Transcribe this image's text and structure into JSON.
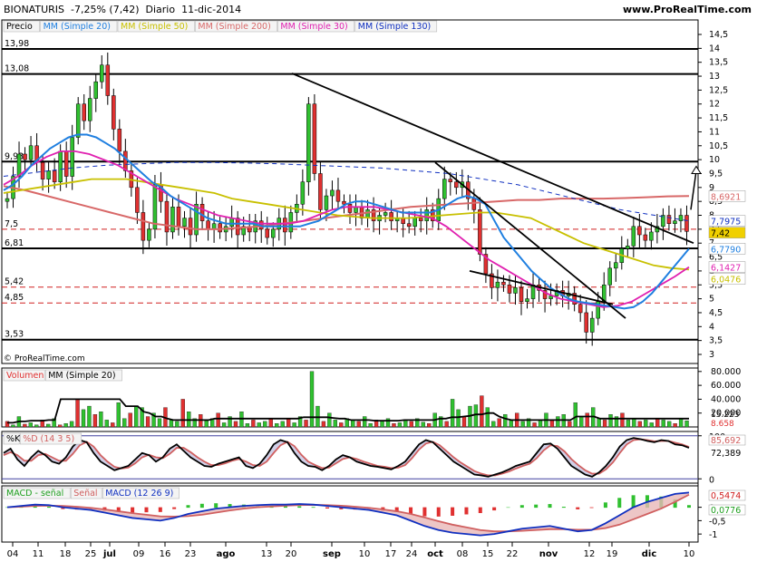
{
  "header": {
    "ticker": "BIONATURIS",
    "change": "-7,25% (7,42)",
    "period": "Diario",
    "date": "11-dic-2014",
    "site": "www.ProRealTime.com"
  },
  "colors": {
    "sma20": "#1f7fe0",
    "sma50": "#c8c000",
    "sma200": "#d86868",
    "sma30": "#e020b0",
    "sma130": "#1030c0",
    "up_candle": "#30c030",
    "down_candle": "#e03030",
    "panel_border": "#000000"
  },
  "chart_data": [
    {
      "type": "candlestick",
      "panel": "price",
      "legend": [
        "Precio",
        "MM (Simple 20)",
        "MM (Simple 50)",
        "MM (Simple 200)",
        "MM (Simple 30)",
        "MM (Simple 130)"
      ],
      "y_ticks": [
        "14,5",
        "14",
        "13,5",
        "13",
        "12,5",
        "12",
        "11,5",
        "11",
        "10,5",
        "10",
        "9,5",
        "9",
        "8,5",
        "8",
        "7,5",
        "7",
        "6,5",
        "6",
        "5,5",
        "5",
        "4,5",
        "4",
        "3,5",
        "3"
      ],
      "ylim": [
        3,
        14.5
      ],
      "x_ticks": [
        "04",
        "11",
        "18",
        "25",
        "jul",
        "09",
        "16",
        "23",
        "ago",
        "13",
        "20",
        "sep",
        "10",
        "17",
        "24",
        "oct",
        "08",
        "15",
        "22",
        "nov",
        "12",
        "19",
        "dic",
        "10"
      ],
      "last_price": 7.42,
      "value_labels": {
        "sma130": "7,7975",
        "last": "7,42",
        "sma200": "8,6921",
        "sma20": "6,7790",
        "sma30": "6,1427",
        "sma50": "6,0476"
      },
      "horizontal_levels": [
        {
          "value": 13.98,
          "label": "13,98",
          "style": "solid"
        },
        {
          "value": 13.08,
          "label": "13,08",
          "style": "solid"
        },
        {
          "value": 9.93,
          "label": "9,93",
          "style": "solid"
        },
        {
          "value": 7.5,
          "label": "7,5",
          "style": "dashed-red"
        },
        {
          "value": 6.81,
          "label": "6,81",
          "style": "solid"
        },
        {
          "value": 5.42,
          "label": "5,42",
          "style": "dashed-red"
        },
        {
          "value": 4.85,
          "label": "4,85",
          "style": "dashed-red"
        },
        {
          "value": 3.53,
          "label": "3,53",
          "style": "solid"
        }
      ],
      "closes": [
        8.6,
        9.4,
        10.2,
        10.0,
        10.5,
        9.9,
        9.3,
        9.6,
        9.2,
        10.3,
        9.4,
        10.8,
        12.0,
        11.4,
        12.2,
        12.8,
        13.4,
        12.3,
        11.1,
        10.3,
        9.6,
        9.0,
        8.1,
        7.1,
        7.5,
        9.1,
        8.5,
        7.4,
        8.3,
        7.6,
        7.9,
        7.3,
        8.4,
        7.8,
        7.5,
        7.7,
        7.4,
        7.6,
        7.9,
        7.3,
        7.6,
        7.4,
        7.8,
        7.5,
        7.2,
        7.5,
        7.9,
        7.4,
        8.1,
        8.4,
        9.2,
        12.0,
        9.5,
        8.2,
        8.7,
        8.9,
        8.5,
        8.4,
        8.1,
        8.3,
        7.9,
        8.2,
        7.8,
        8.0,
        8.1,
        7.8,
        7.9,
        7.7,
        7.6,
        7.9,
        7.8,
        8.2,
        7.8,
        8.6,
        9.3,
        9.2,
        9.0,
        9.2,
        8.6,
        8.2,
        6.6,
        5.9,
        5.4,
        5.6,
        5.5,
        5.2,
        5.4,
        4.9,
        5.0,
        5.5,
        5.3,
        5.0,
        5.1,
        5.3,
        5.1,
        5.2,
        4.8,
        4.5,
        3.8,
        4.3,
        4.9,
        5.5,
        6.1,
        6.3,
        6.8,
        6.9,
        7.6,
        7.3,
        7.1,
        7.4,
        7.6,
        8.0,
        7.7,
        7.8,
        8.0,
        7.42
      ],
      "sma20": [
        8.9,
        9.1,
        9.4,
        9.8,
        10.1,
        10.4,
        10.6,
        10.8,
        10.9,
        10.9,
        10.8,
        10.6,
        10.4,
        10.1,
        9.8,
        9.5,
        9.2,
        9.0,
        8.7,
        8.5,
        8.3,
        8.1,
        7.9,
        7.8,
        7.7,
        7.7,
        7.7,
        7.7,
        7.6,
        7.6,
        7.6,
        7.6,
        7.6,
        7.7,
        7.8,
        8.0,
        8.2,
        8.4,
        8.5,
        8.5,
        8.4,
        8.3,
        8.2,
        8.1,
        8.1,
        8.1,
        8.1,
        8.2,
        8.4,
        8.6,
        8.7,
        8.6,
        8.4,
        7.8,
        7.2,
        6.8,
        6.4,
        6.0,
        5.7,
        5.4,
        5.2,
        5.0,
        4.9,
        4.85,
        4.8,
        4.75,
        4.7,
        4.65,
        4.7,
        4.9,
        5.2,
        5.6,
        6.0,
        6.4,
        6.8
      ],
      "sma50": [
        8.8,
        8.9,
        9.0,
        9.1,
        9.2,
        9.3,
        9.3,
        9.3,
        9.2,
        9.1,
        9.0,
        8.9,
        8.8,
        8.6,
        8.5,
        8.4,
        8.3,
        8.2,
        8.1,
        8.0,
        7.95,
        7.9,
        7.9,
        7.9,
        7.95,
        8.0,
        8.05,
        8.1,
        8.1,
        8.0,
        7.9,
        7.6,
        7.3,
        7.0,
        6.8,
        6.6,
        6.4,
        6.2,
        6.1,
        6.05
      ],
      "sma200": [
        9.05,
        8.9,
        8.7,
        8.5,
        8.3,
        8.1,
        7.9,
        7.7,
        7.6,
        7.5,
        7.5,
        7.55,
        7.6,
        7.7,
        7.8,
        7.9,
        8.0,
        8.1,
        8.2,
        8.3,
        8.35,
        8.4,
        8.45,
        8.5,
        8.55,
        8.55,
        8.6,
        8.6,
        8.6,
        8.62,
        8.65,
        8.68,
        8.69
      ],
      "sma30": [
        9.1,
        9.4,
        9.8,
        10.1,
        10.3,
        10.3,
        10.2,
        10.0,
        9.8,
        9.5,
        9.2,
        8.9,
        8.6,
        8.4,
        8.2,
        8.0,
        7.9,
        7.8,
        7.7,
        7.7,
        7.7,
        7.8,
        8.0,
        8.2,
        8.3,
        8.3,
        8.3,
        8.2,
        8.1,
        8.0,
        7.9,
        7.6,
        7.2,
        6.8,
        6.4,
        6.1,
        5.8,
        5.5,
        5.2,
        5.0,
        4.9,
        4.8,
        4.7,
        4.75,
        4.9,
        5.2,
        5.5,
        5.8,
        6.14
      ],
      "sma130": [
        9.4,
        9.55,
        9.7,
        9.8,
        9.85,
        9.9,
        9.9,
        9.88,
        9.85,
        9.8,
        9.75,
        9.7,
        9.6,
        9.5,
        9.3,
        9.1,
        8.8,
        8.5,
        8.2,
        8.0,
        7.8
      ]
    },
    {
      "type": "bar",
      "panel": "volume",
      "legend": [
        "Volumen",
        "MM (Simple 20)"
      ],
      "y_ticks": [
        "80.000",
        "60.000",
        "40.000",
        "20.000"
      ],
      "ylim": [
        0,
        85000
      ],
      "value_labels": [
        "15.223",
        "8.658"
      ],
      "values": [
        8,
        3,
        15,
        4,
        6,
        3,
        10,
        4,
        12,
        3,
        5,
        8,
        40,
        25,
        30,
        18,
        22,
        10,
        6,
        35,
        12,
        20,
        30,
        28,
        15,
        20,
        12,
        28,
        10,
        8,
        40,
        22,
        12,
        18,
        9,
        12,
        20,
        6,
        15,
        8,
        22,
        5,
        10,
        6,
        8,
        12,
        5,
        8,
        12,
        6,
        15,
        10,
        80,
        30,
        8,
        20,
        10,
        6,
        12,
        10,
        8,
        15,
        5,
        10,
        8,
        12,
        5,
        6,
        10,
        8,
        12,
        7,
        5,
        20,
        15,
        8,
        40,
        25,
        15,
        30,
        32,
        45,
        28,
        8,
        12,
        18,
        10,
        20,
        8,
        12,
        6,
        10,
        20,
        10,
        15,
        18,
        8,
        35,
        15,
        20,
        28,
        12,
        10,
        18,
        15,
        20,
        10,
        12,
        8,
        10,
        6,
        12,
        10,
        8,
        5,
        12,
        9
      ],
      "ma20": [
        6,
        6,
        8,
        8,
        9,
        9,
        9,
        10,
        10,
        40,
        40,
        40,
        40,
        40,
        40,
        40,
        40,
        40,
        40,
        40,
        30,
        30,
        30,
        22,
        20,
        15,
        15,
        12,
        10,
        10,
        10,
        10,
        10,
        10,
        10,
        12,
        12,
        12,
        12,
        12,
        12,
        12,
        12,
        12,
        12,
        12,
        12,
        12,
        12,
        12,
        14,
        14,
        14,
        14,
        14,
        13,
        12,
        12,
        10,
        10,
        10,
        10,
        9,
        9,
        9,
        9,
        9,
        10,
        10,
        10,
        10,
        10,
        10,
        12,
        12,
        14,
        14,
        15,
        16,
        18,
        18,
        20,
        20,
        15,
        12,
        10,
        10,
        10,
        10,
        10,
        10,
        10,
        10,
        10,
        10,
        10,
        15,
        15,
        15,
        15,
        12,
        12,
        12,
        12,
        12,
        12,
        12,
        12,
        12,
        12,
        12,
        12,
        12,
        12,
        12,
        12
      ]
    },
    {
      "type": "line",
      "panel": "stochastic",
      "legend": [
        "%K",
        "%D (14 3 5)"
      ],
      "y_ticks": [
        "100",
        "0"
      ],
      "ylim": [
        -10,
        110
      ],
      "value_labels": [
        "85,692",
        "72,389"
      ],
      "k": [
        60,
        70,
        45,
        30,
        50,
        65,
        55,
        40,
        35,
        50,
        75,
        90,
        85,
        60,
        40,
        30,
        20,
        25,
        30,
        45,
        60,
        55,
        40,
        50,
        70,
        80,
        65,
        50,
        40,
        30,
        28,
        35,
        40,
        45,
        50,
        30,
        25,
        35,
        55,
        80,
        90,
        85,
        60,
        40,
        30,
        28,
        20,
        30,
        45,
        55,
        50,
        40,
        35,
        30,
        28,
        25,
        22,
        30,
        40,
        60,
        80,
        90,
        85,
        70,
        55,
        40,
        30,
        20,
        10,
        8,
        5,
        10,
        15,
        22,
        30,
        35,
        40,
        60,
        80,
        82,
        70,
        50,
        30,
        20,
        10,
        5,
        15,
        30,
        50,
        75,
        90,
        95,
        92,
        88,
        85,
        90,
        88,
        80,
        78,
        72
      ],
      "d": [
        55,
        62,
        55,
        42,
        42,
        55,
        58,
        50,
        42,
        42,
        58,
        78,
        86,
        75,
        55,
        40,
        28,
        24,
        26,
        36,
        50,
        56,
        50,
        48,
        58,
        72,
        72,
        62,
        50,
        40,
        32,
        32,
        36,
        42,
        46,
        40,
        32,
        30,
        40,
        60,
        78,
        86,
        76,
        56,
        40,
        32,
        25,
        26,
        36,
        46,
        50,
        46,
        40,
        35,
        30,
        28,
        25,
        26,
        32,
        48,
        68,
        82,
        86,
        78,
        64,
        50,
        38,
        28,
        18,
        12,
        8,
        8,
        12,
        17,
        24,
        30,
        35,
        48,
        66,
        78,
        76,
        64,
        46,
        32,
        20,
        12,
        12,
        22,
        38,
        60,
        80,
        90,
        92,
        90,
        87,
        88,
        88,
        84,
        80,
        74
      ]
    },
    {
      "type": "bar+line",
      "panel": "macd",
      "legend": [
        "MACD - señal",
        "Señal",
        "MACD (12 26 9)"
      ],
      "y_ticks": [
        "0",
        "-0,5",
        "-1"
      ],
      "ylim": [
        -1.3,
        0.8
      ],
      "value_labels": [
        "0,5474",
        "0,0776"
      ],
      "macd": [
        0.0,
        0.05,
        0.1,
        0.08,
        0.0,
        -0.05,
        -0.1,
        -0.2,
        -0.3,
        -0.4,
        -0.45,
        -0.5,
        -0.4,
        -0.25,
        -0.15,
        -0.05,
        0.0,
        0.05,
        0.08,
        0.1,
        0.1,
        0.12,
        0.1,
        0.05,
        0.0,
        -0.05,
        -0.1,
        -0.2,
        -0.3,
        -0.5,
        -0.7,
        -0.85,
        -0.95,
        -1.0,
        -1.05,
        -1.0,
        -0.9,
        -0.8,
        -0.75,
        -0.7,
        -0.8,
        -0.9,
        -0.85,
        -0.6,
        -0.3,
        0.0,
        0.2,
        0.35,
        0.5,
        0.55
      ],
      "signal": [
        0.0,
        0.02,
        0.05,
        0.06,
        0.05,
        0.02,
        -0.02,
        -0.08,
        -0.15,
        -0.22,
        -0.28,
        -0.34,
        -0.35,
        -0.33,
        -0.28,
        -0.2,
        -0.12,
        -0.05,
        0.0,
        0.03,
        0.06,
        0.08,
        0.09,
        0.08,
        0.06,
        0.02,
        -0.02,
        -0.08,
        -0.15,
        -0.25,
        -0.38,
        -0.52,
        -0.65,
        -0.75,
        -0.85,
        -0.9,
        -0.9,
        -0.88,
        -0.85,
        -0.82,
        -0.82,
        -0.84,
        -0.84,
        -0.78,
        -0.65,
        -0.45,
        -0.25,
        -0.05,
        0.2,
        0.47
      ]
    }
  ],
  "footer": {
    "copyright": "© ProRealTime.com"
  }
}
